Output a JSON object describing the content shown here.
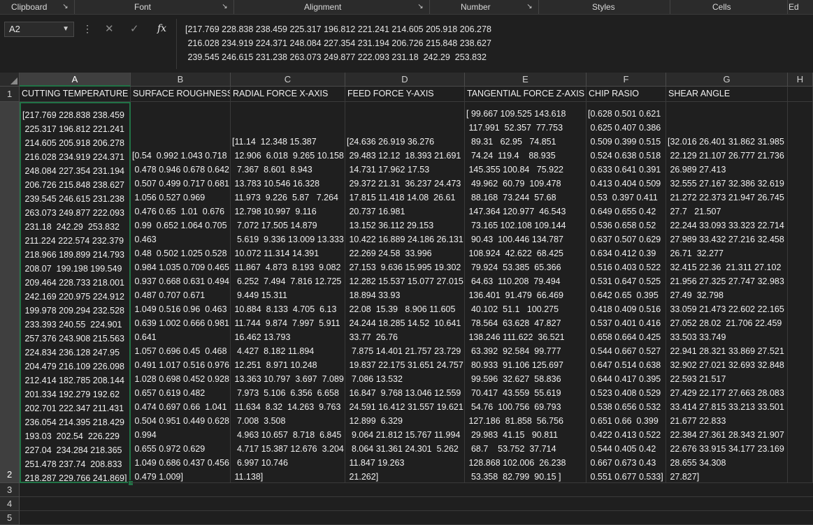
{
  "ribbon": {
    "groups": [
      "Clipboard",
      "Font",
      "Alignment",
      "Number",
      "Styles",
      "Cells",
      "Ed"
    ]
  },
  "namebox": {
    "value": "A2"
  },
  "formula": {
    "fx": "fx",
    "lines": [
      "[217.769 228.838 238.459 225.317 196.812 221.241 214.605 205.918 206.278",
      " 216.028 234.919 224.371 248.084 227.354 231.194 206.726 215.848 238.627",
      " 239.545 246.615 231.238 263.073 249.877 222.093 231.18  242.29  253.832"
    ]
  },
  "columns": [
    "A",
    "B",
    "C",
    "D",
    "E",
    "F",
    "G",
    "H"
  ],
  "rows": [
    "1",
    "2",
    "3",
    "4",
    "5"
  ],
  "headers": [
    "CUTTING TEMPERATURE",
    "SURFACE ROUGHNESS",
    "RADIAL FORCE X-AXIS",
    "FEED FORCE Y-AXIS",
    "TANGENTIAL FORCE Z-AXIS",
    "CHIP RASIO",
    "SHEAR ANGLE"
  ],
  "row2": {
    "A": [
      "[217.769 228.838 238.459",
      " 225.317 196.812 221.241",
      " 214.605 205.918 206.278",
      " 216.028 234.919 224.371",
      " 248.084 227.354 231.194",
      " 206.726 215.848 238.627",
      " 239.545 246.615 231.238",
      " 263.073 249.877 222.093",
      " 231.18  242.29  253.832",
      " 211.224 222.574 232.379",
      " 218.966 189.899 214.793",
      " 208.07  199.198 199.549",
      " 209.464 228.733 218.001",
      " 242.169 220.975 224.912",
      " 199.978 209.294 232.528",
      " 233.393 240.55  224.901",
      " 257.376 243.908 215.563",
      " 224.834 236.128 247.95",
      " 204.479 216.109 226.098",
      " 212.414 182.785 208.144",
      " 201.334 192.279 192.62",
      " 202.701 222.347 211.431",
      " 236.054 214.395 218.429",
      " 193.03  202.54  226.229",
      " 227.04  234.284 218.365",
      " 251.478 237.74  208.833",
      " 218.287 229.766 241.869]"
    ],
    "B": [
      "",
      "",
      "",
      "[0.54  0.992 1.043 0.718",
      " 0.478 0.946 0.678 0.642",
      " 0.507 0.499 0.717 0.681",
      " 1.056 0.527 0.969",
      " 0.476 0.65  1.01  0.676",
      " 0.99  0.652 1.064 0.705",
      " 0.463",
      " 0.48  0.502 1.025 0.528",
      " 0.984 1.035 0.709 0.465",
      " 0.937 0.668 0.631 0.494",
      " 0.487 0.707 0.671",
      " 1.049 0.516 0.96  0.463",
      " 0.639 1.002 0.666 0.981",
      " 0.641",
      " 1.057 0.696 0.45  0.468",
      " 0.491 1.017 0.516 0.976",
      " 1.028 0.698 0.452 0.928",
      " 0.657 0.619 0.482",
      " 0.474 0.697 0.66  1.041",
      " 0.504 0.951 0.449 0.628",
      " 0.994",
      " 0.655 0.972 0.629",
      " 1.049 0.686 0.437 0.456",
      " 0.479 1.009]"
    ],
    "C": [
      "",
      "",
      "[11.14  12.348 15.387",
      " 12.906  6.018  9.265 10.158",
      "  7.367  8.601  8.943",
      " 13.783 10.546 16.328",
      " 11.973  9.226  5.87   7.264",
      " 12.798 10.997  9.116",
      "  7.072 17.505 14.879",
      "  5.619  9.336 13.009 13.333",
      " 10.072 11.314 14.391",
      " 11.867  4.873  8.193  9.082",
      "  6.252  7.494  7.816 12.725",
      "  9.449 15.311",
      " 10.884  8.133  4.705  6.13",
      " 11.744  9.874  7.997  5.911",
      " 16.462 13.793",
      "  4.427  8.182 11.894",
      " 12.251  8.971 10.248",
      " 13.363 10.797  3.697  7.089",
      "  7.973  5.106  6.356  6.658",
      " 11.634  8.32  14.263  9.763",
      "  7.008  3.508",
      "  4.963 10.657  8.718  6.845",
      "  4.717 15.387 12.676  3.204",
      "  6.997 10.746",
      " 11.138]"
    ],
    "D": [
      "",
      "",
      "[24.636 26.919 36.276",
      " 29.483 12.12  18.393 21.691",
      " 14.731 17.962 17.53",
      " 29.372 21.31  36.237 24.473",
      " 17.815 11.418 14.08  26.61",
      " 20.737 16.981",
      " 13.152 36.112 29.153",
      " 10.422 16.889 24.186 26.131",
      " 22.269 24.58  33.996",
      " 27.153  9.636 15.995 19.302",
      " 12.282 15.537 15.077 27.015",
      " 18.894 33.93",
      " 22.08  15.39   8.906 11.605",
      " 24.244 18.285 14.52  10.641",
      " 33.77  26.76",
      "  7.875 14.401 21.757 23.729",
      " 19.837 22.175 31.651 24.757",
      "  7.086 13.532",
      " 16.847  9.768 13.046 12.559",
      " 24.591 16.412 31.557 19.621",
      " 12.899  6.329",
      "  9.064 21.812 15.767 11.994",
      "  8.064 31.361 24.301  5.262",
      " 11.847 19.263",
      " 21.262]"
    ],
    "E": [
      "[ 99.667 109.525 143.618",
      " 117.991  52.357  77.753",
      "  89.31   62.95   74.851",
      "  74.24  119.4    88.935",
      " 145.355 100.84   75.922",
      "  49.962  60.79  109.478",
      "  88.168  73.244  57.68",
      " 147.364 120.977  46.543",
      "  73.165 102.108 109.144",
      "  90.43  100.446 134.787",
      " 108.924  42.622  68.425",
      "  79.924  53.385  65.366",
      "  64.63  110.208  79.494",
      " 136.401  91.479  66.469",
      "  40.102  51.1   100.275",
      "  78.564  63.628  47.827",
      " 138.246 111.622  36.521",
      "  63.392  92.584  99.777",
      "  80.933  91.106 125.697",
      "  99.596  32.627  58.836",
      "  70.417  43.559  55.619",
      "  54.76  100.756  69.793",
      " 127.186  81.858  56.756",
      "  29.983  41.15   90.811",
      "  68.7    53.752  37.714",
      " 128.868 102.006  26.238",
      "  53.358  82.799  90.15 ]"
    ],
    "F": [
      "[0.628 0.501 0.621",
      " 0.625 0.407 0.386",
      " 0.509 0.399 0.515",
      " 0.524 0.638 0.518",
      " 0.633 0.641 0.391",
      " 0.413 0.404 0.509",
      " 0.53  0.397 0.411",
      " 0.649 0.655 0.42",
      " 0.536 0.658 0.52",
      " 0.637 0.507 0.629",
      " 0.634 0.412 0.39",
      " 0.516 0.403 0.522",
      " 0.531 0.647 0.525",
      " 0.642 0.65  0.395",
      " 0.418 0.409 0.516",
      " 0.537 0.401 0.416",
      " 0.658 0.664 0.425",
      " 0.544 0.667 0.527",
      " 0.647 0.514 0.638",
      " 0.644 0.417 0.395",
      " 0.523 0.408 0.529",
      " 0.538 0.656 0.532",
      " 0.651 0.66  0.399",
      " 0.422 0.413 0.522",
      " 0.544 0.405 0.42",
      " 0.667 0.673 0.43",
      " 0.551 0.677 0.533]"
    ],
    "G": [
      "",
      "",
      "[32.016 26.401 31.862 31.985",
      " 22.129 21.107 26.777 21.736",
      " 26.989 27.413",
      " 32.555 27.167 32.386 32.619",
      " 21.272 22.373 21.947 26.745",
      " 27.7   21.507",
      " 22.244 33.093 33.323 22.714",
      " 27.989 33.432 27.216 32.458",
      " 26.71  32.277",
      " 32.415 22.36  21.311 27.102",
      " 21.956 27.325 27.747 32.983",
      " 27.49  32.798",
      " 33.059 21.473 22.602 22.165",
      " 27.052 28.02  21.706 22.459",
      " 33.503 33.749",
      " 22.941 28.321 33.869 27.521",
      " 32.902 27.021 32.693 32.848",
      " 22.593 21.517",
      " 27.429 22.177 27.663 28.083",
      " 33.414 27.815 33.213 33.501",
      " 21.677 22.833",
      " 22.384 27.361 28.343 21.907",
      " 22.676 33.915 34.177 23.169",
      " 28.655 34.308",
      " 27.827]"
    ]
  }
}
